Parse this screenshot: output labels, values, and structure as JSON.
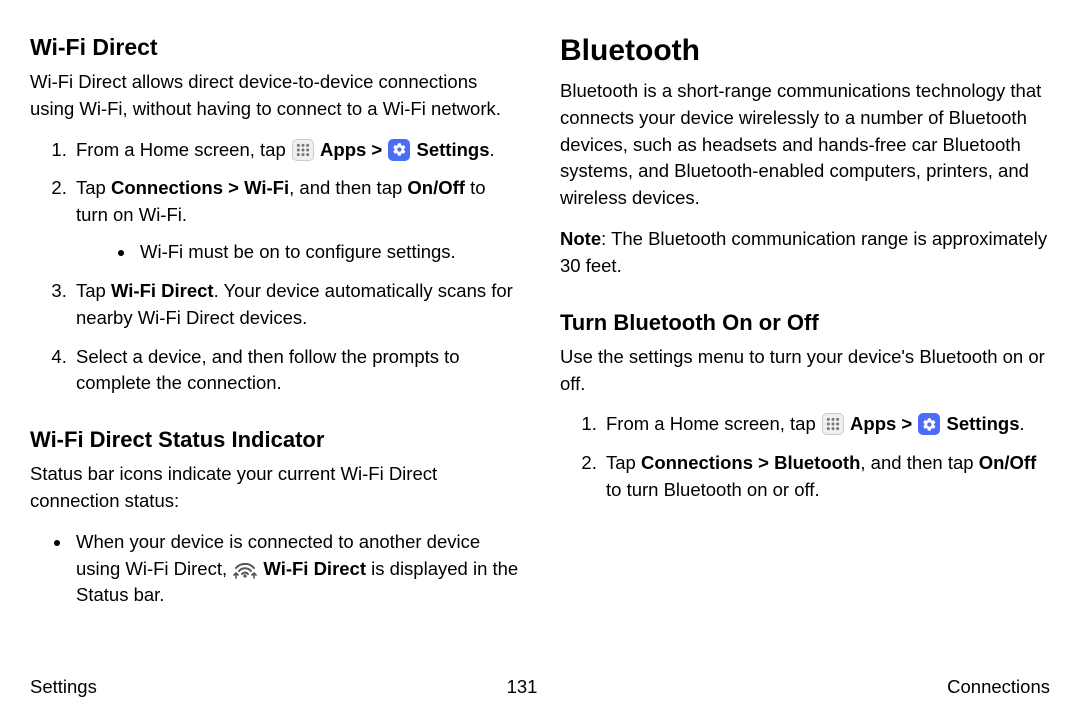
{
  "left": {
    "h_wifidirect": "Wi‑Fi Direct",
    "p_wifidirect": "Wi‑Fi Direct allows direct device‑to‑device connections using Wi‑Fi, without having to connect to a Wi‑Fi network.",
    "step1a": "From a Home screen, tap ",
    "apps": "Apps",
    "sep": " > ",
    "settings": "Settings",
    "period": ".",
    "step2a": "Tap ",
    "step2b": "Connections > Wi‑Fi",
    "step2c": ", and then tap ",
    "step2d": "On/Off",
    "step2e": " to turn on Wi‑Fi.",
    "step2bullet": "Wi‑Fi must be on to configure settings.",
    "step3a": "Tap ",
    "step3b": "Wi‑Fi Direct",
    "step3c": ". Your device automatically scans for nearby Wi‑Fi Direct devices.",
    "step4": "Select a device, and then follow the prompts to complete the connection.",
    "h_status": "Wi‑Fi Direct Status Indicator",
    "p_status": "Status bar icons indicate your current Wi‑Fi Direct connection status:",
    "bullet_a": "When your device is connected to another device using Wi‑Fi Direct, ",
    "bullet_b": "Wi‑Fi Direct",
    "bullet_c": " is displayed in the Status bar."
  },
  "right": {
    "h_bt": "Bluetooth",
    "p_bt": "Bluetooth is a short‑range communications technology that connects your device wirelessly to a number of Bluetooth devices, such as headsets and hands‑free car Bluetooth systems, and Bluetooth‑enabled computers, printers, and wireless devices.",
    "note_label": "Note",
    "note_body": ": The Bluetooth communication range is approximately 30 feet.",
    "h_turn": "Turn Bluetooth On or Off",
    "p_turn": "Use the settings menu to turn your device's Bluetooth on or off.",
    "step1a": "From a Home screen, tap ",
    "apps": "Apps",
    "sep": " > ",
    "settings": "Settings",
    "period": ".",
    "step2a": "Tap ",
    "step2b": "Connections > Bluetooth",
    "step2c": ", and then tap ",
    "step2d": "On/Off",
    "step2e": " to turn Bluetooth on or off."
  },
  "footer": {
    "left": "Settings",
    "center": "131",
    "right": "Connections"
  }
}
